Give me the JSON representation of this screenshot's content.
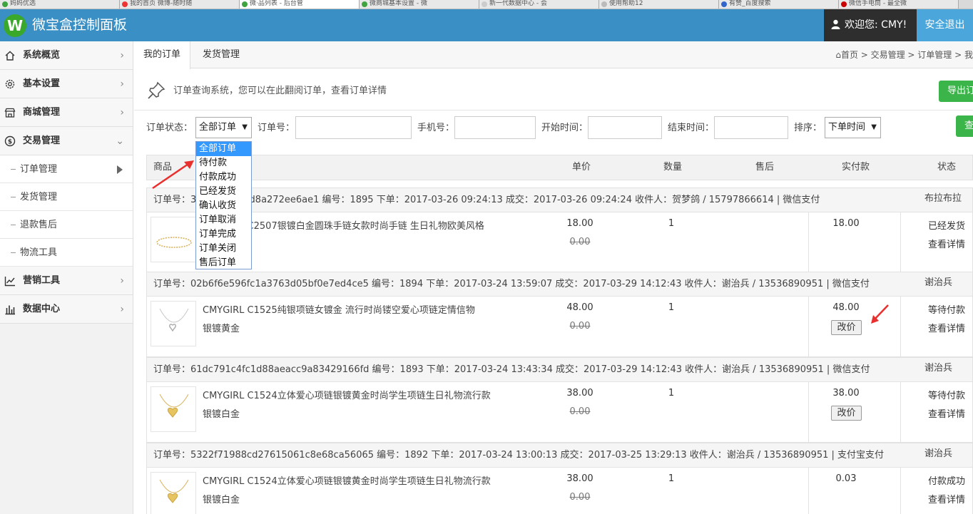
{
  "browser": {
    "tabs": [
      {
        "label": "妈妈优选"
      },
      {
        "label": "我的首页 微博-随时随"
      },
      {
        "label": "微·品列表 - 后台管"
      },
      {
        "label": "微商城基本设置 - 微"
      },
      {
        "label": "新一代数据中心 - 会"
      },
      {
        "label": "使用帮助12"
      },
      {
        "label": "有赞_百度搜索"
      },
      {
        "label": "微信手电筒 - 最全微"
      }
    ]
  },
  "header": {
    "logo_letter": "W",
    "title": "微宝盒控制面板",
    "welcome": "欢迎您: CMY!",
    "logout": "安全退出"
  },
  "sidebar": {
    "items": [
      {
        "label": "系统概览",
        "icon": "home-icon"
      },
      {
        "label": "基本设置",
        "icon": "gear-icon"
      },
      {
        "label": "商城管理",
        "icon": "shop-icon"
      },
      {
        "label": "交易管理",
        "icon": "dollar-icon"
      }
    ],
    "sub_items": [
      {
        "label": "订单管理"
      },
      {
        "label": "发货管理"
      },
      {
        "label": "退款售后"
      },
      {
        "label": "物流工具"
      }
    ],
    "more_items": [
      {
        "label": "营销工具",
        "icon": "chart-line-icon"
      },
      {
        "label": "数据中心",
        "icon": "bar-chart-icon"
      }
    ]
  },
  "tabs": [
    {
      "label": "我的订单"
    },
    {
      "label": "发货管理"
    }
  ],
  "breadcrumb": "首页 > 交易管理 > 订单管理 > 我",
  "notice": {
    "text": "订单查询系统，您可以在此翻阅订单，查看订单详情",
    "export_button": "导出订"
  },
  "filters": {
    "status_label": "订单状态：",
    "status_value": "全部订单",
    "order_no_label": "订单号：",
    "phone_label": "手机号：",
    "start_label": "开始时间：",
    "end_label": "结束时间：",
    "sort_label": "排序：",
    "sort_value": "下单时间",
    "search_button": "查"
  },
  "dropdown_options": [
    "全部订单",
    "待付款",
    "付款成功",
    "已经发货",
    "确认收货",
    "订单取消",
    "订单完成",
    "订单关闭",
    "售后订单"
  ],
  "table": {
    "headers": [
      "商品",
      "单价",
      "数量",
      "售后",
      "实付款",
      "状态"
    ]
  },
  "orders": [
    {
      "head": "订单号：3 8d9a9ef65d8a272ee6ae1 编号：1895 下单：2017-03-26 09:24:13 成交：2017-03-26 09:24:24 收件人：贺梦鸽 / 15797866614 | 微信支付",
      "buyer": "布拉布拉",
      "product": "CMYGIRL C2507银镀白金圆珠手链女款时尚手链 生日礼物欧美风格",
      "spec": "",
      "unit_price": "18.00",
      "orig_price": "0.00",
      "qty": "1",
      "paid": "18.00",
      "change_label": "",
      "status": "已经发货",
      "detail": "查看详情"
    },
    {
      "head": "订单号：02b6f6e596fc1a3763d05bf0e7ed4ce5 编号：1894 下单：2017-03-24 13:59:07 成交：2017-03-29 14:12:43 收件人：谢治兵 / 13536890951 | 微信支付",
      "buyer": "谢治兵",
      "product": "CMYGIRL C1525纯银项链女镀金 流行时尚镂空爱心项链定情信物",
      "spec": "银镀黄金",
      "unit_price": "48.00",
      "orig_price": "0.00",
      "qty": "1",
      "paid": "48.00",
      "change_label": "改价",
      "status": "等待付款",
      "detail": "查看详情"
    },
    {
      "head": "订单号：61dc791c4fc1d88aeacc9a83429166fd 编号：1893 下单：2017-03-24 13:43:34 成交：2017-03-29 14:12:43 收件人：谢治兵 / 13536890951 | 微信支付",
      "buyer": "谢治兵",
      "product": "CMYGIRL C1524立体爱心项链银镀黄金时尚学生项链生日礼物流行款",
      "spec": "银镀白金",
      "unit_price": "38.00",
      "orig_price": "0.00",
      "qty": "1",
      "paid": "38.00",
      "change_label": "改价",
      "status": "等待付款",
      "detail": "查看详情"
    },
    {
      "head": "订单号：5322f71988cd27615061c8e68ca56065 编号：1892 下单：2017-03-24 13:00:13 成交：2017-03-25 13:29:13 收件人：谢治兵 / 13536890951 | 支付宝支付",
      "buyer": "谢治兵",
      "product": "CMYGIRL C1524立体爱心项链银镀黄金时尚学生项链生日礼物流行款",
      "spec": "银镀白金",
      "unit_price": "38.00",
      "orig_price": "0.00",
      "qty": "1",
      "paid": "0.03",
      "change_label": "",
      "status": "付款成功",
      "detail": "查看详情"
    }
  ]
}
